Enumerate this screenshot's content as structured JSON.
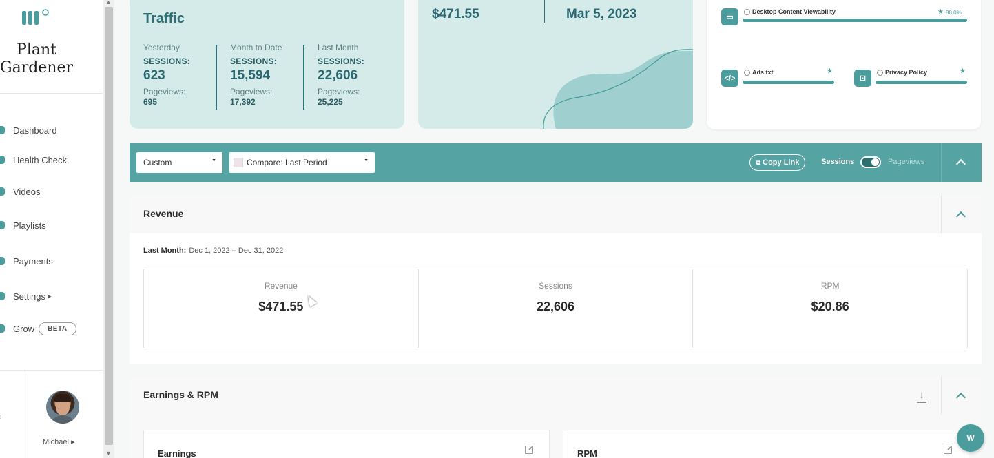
{
  "brand": {
    "line1": "Plant",
    "line2": "Gardener"
  },
  "sidebar": {
    "items": [
      {
        "label": "Dashboard",
        "icon": "dashboard-icon"
      },
      {
        "label": "Health Check",
        "icon": "health-check-icon"
      },
      {
        "label": "Videos",
        "icon": "video-icon"
      },
      {
        "label": "Playlists",
        "icon": "playlist-icon"
      },
      {
        "label": "Payments",
        "icon": "payments-icon"
      },
      {
        "label": "Settings",
        "icon": "settings-icon",
        "caret": "▸"
      },
      {
        "label": "Grow",
        "icon": "grow-icon",
        "badge": "BETA"
      }
    ],
    "user": {
      "name": "Michael ▸"
    }
  },
  "traffic": {
    "title": "Traffic",
    "columns": [
      {
        "period": "Yesterday",
        "sessions_label": "SESSIONS:",
        "sessions": "623",
        "pageviews_label": "Pageviews:",
        "pageviews": "695"
      },
      {
        "period": "Month to Date",
        "sessions_label": "SESSIONS:",
        "sessions": "15,594",
        "pageviews_label": "Pageviews:",
        "pageviews": "17,392"
      },
      {
        "period": "Last Month",
        "sessions_label": "SESSIONS:",
        "sessions": "22,606",
        "pageviews_label": "Pageviews:",
        "pageviews": "25,225"
      }
    ]
  },
  "payment": {
    "amount": "$471.55",
    "date": "Mar 5, 2023"
  },
  "health": {
    "items": [
      {
        "label": "Desktop Content Viewability",
        "icon": "monitor-icon",
        "value": "88.0%",
        "progress": 1.0
      },
      {
        "label": "Ads.txt",
        "icon": "code-icon",
        "progress": 1.0
      },
      {
        "label": "Privacy Policy",
        "icon": "lock-icon",
        "progress": 1.0
      }
    ]
  },
  "toolbar": {
    "range_select": "Custom",
    "compare_select": "Compare: Last Period",
    "copy_link": "Copy Link",
    "toggle_left": "Sessions",
    "toggle_right": "Pageviews"
  },
  "revenue": {
    "title": "Revenue",
    "period_label": "Last Month:",
    "period_range": "Dec 1, 2022 – Dec 31, 2022",
    "metrics": [
      {
        "label": "Revenue",
        "value": "$471.55"
      },
      {
        "label": "Sessions",
        "value": "22,606"
      },
      {
        "label": "RPM",
        "value": "$20.86"
      }
    ]
  },
  "earnings": {
    "title": "Earnings & RPM",
    "cards": [
      {
        "title": "Earnings"
      },
      {
        "title": "RPM"
      }
    ]
  },
  "colors": {
    "accent": "#55a3a2",
    "card_bg": "#d5ebea",
    "heading": "#2f6f78"
  }
}
